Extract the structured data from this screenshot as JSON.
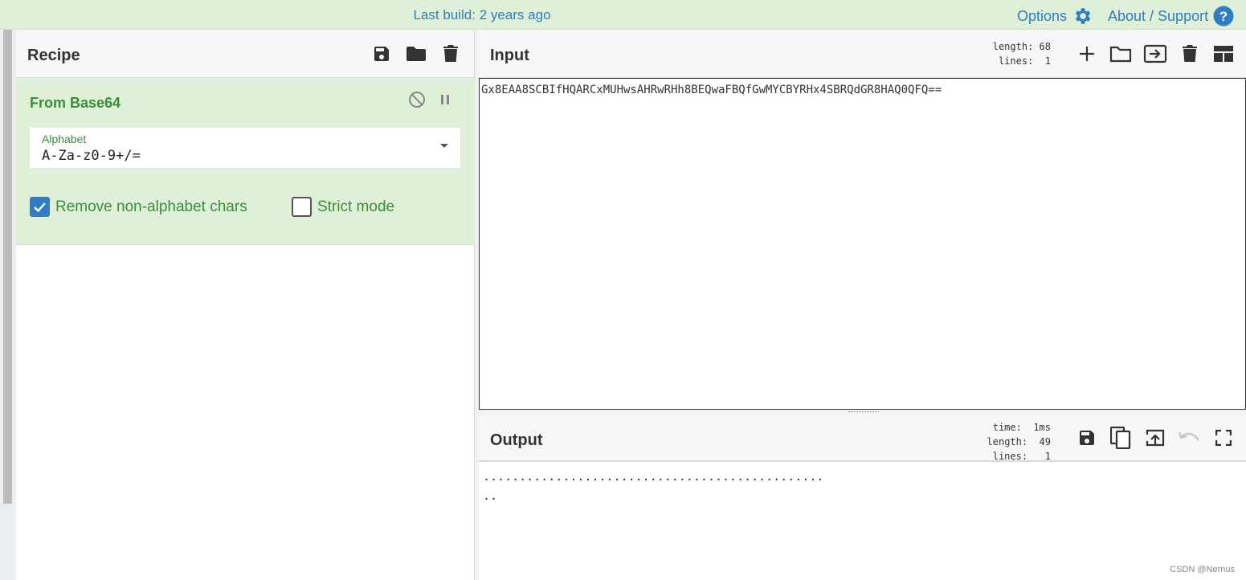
{
  "topbar": {
    "build": "Last build: 2 years ago",
    "options_label": "Options",
    "about_label": "About / Support"
  },
  "recipe": {
    "title": "Recipe",
    "operation": {
      "name": "From Base64",
      "alphabet_label": "Alphabet",
      "alphabet_value": "A-Za-z0-9+/=",
      "remove_nonalpha_label": "Remove non-alphabet chars",
      "remove_nonalpha_checked": true,
      "strict_label": "Strict mode",
      "strict_checked": false
    }
  },
  "input": {
    "title": "Input",
    "length_label": "length:",
    "length_value": "68",
    "lines_label": "lines:",
    "lines_value": "1",
    "text": "Gx8EAA8SCBIfHQARCxMUHwsAHRwRHh8BEQwaFBQfGwMYCBYRHx4SBRQdGR8HAQ0QFQ=="
  },
  "output": {
    "title": "Output",
    "time_label": "time:",
    "time_value": "1ms",
    "length_label": "length:",
    "length_value": "49",
    "lines_label": "lines:",
    "lines_value": "1",
    "line1": "...............................................",
    "line2": ".."
  },
  "watermark": "CSDN @Nernus",
  "colors": {
    "accent_blue": "#2f7dc3",
    "op_green_bg": "#dff0d8",
    "op_green_text": "#3d8b3d",
    "icon_dark": "#333333",
    "icon_disabled": "#c8c8c8"
  }
}
